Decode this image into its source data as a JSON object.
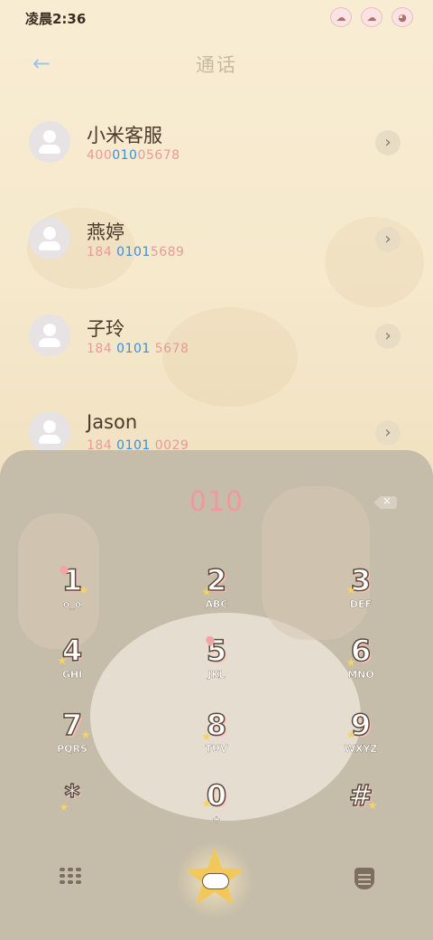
{
  "status_bar": {
    "time": "凌晨2:36"
  },
  "header": {
    "title": "通话",
    "back_icon": "back-arrow-icon"
  },
  "contacts": [
    {
      "name": "小米客服",
      "number_prefix": "400",
      "number_match": "010",
      "number_suffix": "05678"
    },
    {
      "name": "燕婷",
      "number_prefix": "184 ",
      "number_match": "0101",
      "number_suffix": "5689"
    },
    {
      "name": "子玲",
      "number_prefix": "184 ",
      "number_match": "0101",
      "number_suffix": " 5678"
    },
    {
      "name": "Jason",
      "number_prefix": "184 ",
      "number_match": "0101",
      "number_suffix": " 0029"
    }
  ],
  "dialpad": {
    "input": "010",
    "keys": [
      {
        "digit": "1",
        "letters": "o_o"
      },
      {
        "digit": "2",
        "letters": "ABC"
      },
      {
        "digit": "3",
        "letters": "DEF"
      },
      {
        "digit": "4",
        "letters": "GHI"
      },
      {
        "digit": "5",
        "letters": "JKL"
      },
      {
        "digit": "6",
        "letters": "MNO"
      },
      {
        "digit": "7",
        "letters": "PQRS"
      },
      {
        "digit": "8",
        "letters": "TUV"
      },
      {
        "digit": "9",
        "letters": "WXYZ"
      },
      {
        "digit": "*",
        "letters": ""
      },
      {
        "digit": "0",
        "letters": "+"
      },
      {
        "digit": "#",
        "letters": ""
      }
    ]
  },
  "bottom_bar": {
    "left_icon": "dialpad-grid-icon",
    "center_icon": "star-call-icon",
    "right_icon": "contacts-card-icon"
  },
  "colors": {
    "background": "#f7ecd3",
    "accent_blue": "#3b8ee0",
    "number_pink": "#e79a9a",
    "dialpad_bg": "#c5bca9",
    "call_star": "#f3c85a"
  }
}
